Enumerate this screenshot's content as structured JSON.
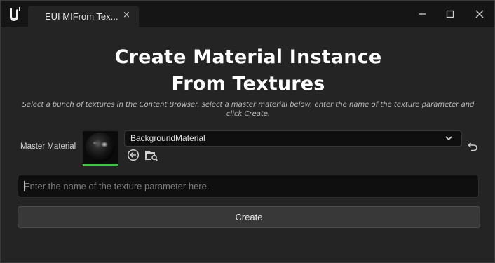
{
  "window": {
    "tab_title": "EUI MIFrom Tex...",
    "tab_close_glyph": "×",
    "controls": [
      "minimize-icon",
      "maximize-icon",
      "close-icon"
    ]
  },
  "content": {
    "heading_line1": "Create Material Instance",
    "heading_line2": "From Textures",
    "hint_line1": "Select a bunch of textures in the Content Browser, select a master material below, enter the name of the texture parameter and",
    "hint_line2": "click Create.",
    "master_material": {
      "label": "Master Material",
      "selected": "BackgroundMaterial",
      "icons": [
        "use-selected-asset-icon",
        "browse-to-asset-icon",
        "reset-to-default-icon"
      ]
    },
    "texture_parameter": {
      "value": "",
      "placeholder": "Enter the name of the texture parameter here."
    },
    "create_label": "Create"
  },
  "colors": {
    "background": "#242424",
    "titlebar": "#151515",
    "input_background": "#0f0f0f",
    "thumbnail_bar": "#3fc246",
    "button": "#383838"
  }
}
